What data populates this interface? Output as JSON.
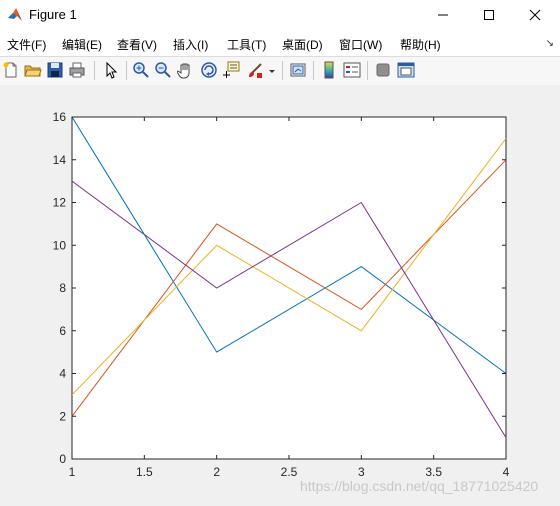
{
  "window": {
    "title": "Figure 1",
    "icon": "matlab-logo-icon",
    "controls": [
      "minimize-icon",
      "maximize-icon",
      "close-icon"
    ]
  },
  "menu": {
    "items": [
      {
        "label": "文件(F)"
      },
      {
        "label": "编辑(E)"
      },
      {
        "label": "查看(V)"
      },
      {
        "label": "插入(I)"
      },
      {
        "label": "工具(T)"
      },
      {
        "label": "桌面(D)"
      },
      {
        "label": "窗口(W)"
      },
      {
        "label": "帮助(H)"
      }
    ],
    "dock_glyph": "↘"
  },
  "toolbar": {
    "buttons": [
      "new-figure-icon",
      "open-file-icon",
      "save-icon",
      "print-icon",
      "edit-plot-pointer-icon",
      "zoom-in-icon",
      "zoom-out-icon",
      "pan-hand-icon",
      "rotate-3d-icon",
      "data-cursor-icon",
      "brush-icon",
      "brush-dropdown-icon",
      "link-plot-icon",
      "colorbar-icon",
      "legend-icon",
      "hide-plot-tools-icon",
      "show-plot-tools-icon"
    ]
  },
  "watermark": "https://blog.csdn.net/qq_18771025420",
  "chart_data": {
    "type": "line",
    "title": "",
    "xlabel": "",
    "ylabel": "",
    "xlim": [
      1,
      4
    ],
    "ylim": [
      0,
      16
    ],
    "x_ticks": [
      "1",
      "1.5",
      "2",
      "2.5",
      "3",
      "3.5",
      "4"
    ],
    "y_ticks": [
      "0",
      "2",
      "4",
      "6",
      "8",
      "10",
      "12",
      "14",
      "16"
    ],
    "grid": false,
    "legend": "none",
    "x": [
      1,
      2,
      3,
      4
    ],
    "series": [
      {
        "values": [
          16,
          5,
          9,
          4
        ],
        "color": "#0072BD"
      },
      {
        "values": [
          2,
          11,
          7,
          14
        ],
        "color": "#D95319"
      },
      {
        "values": [
          3,
          10,
          6,
          15
        ],
        "color": "#EDB120"
      },
      {
        "values": [
          13,
          8,
          12,
          1
        ],
        "color": "#7E2F8E"
      }
    ]
  }
}
